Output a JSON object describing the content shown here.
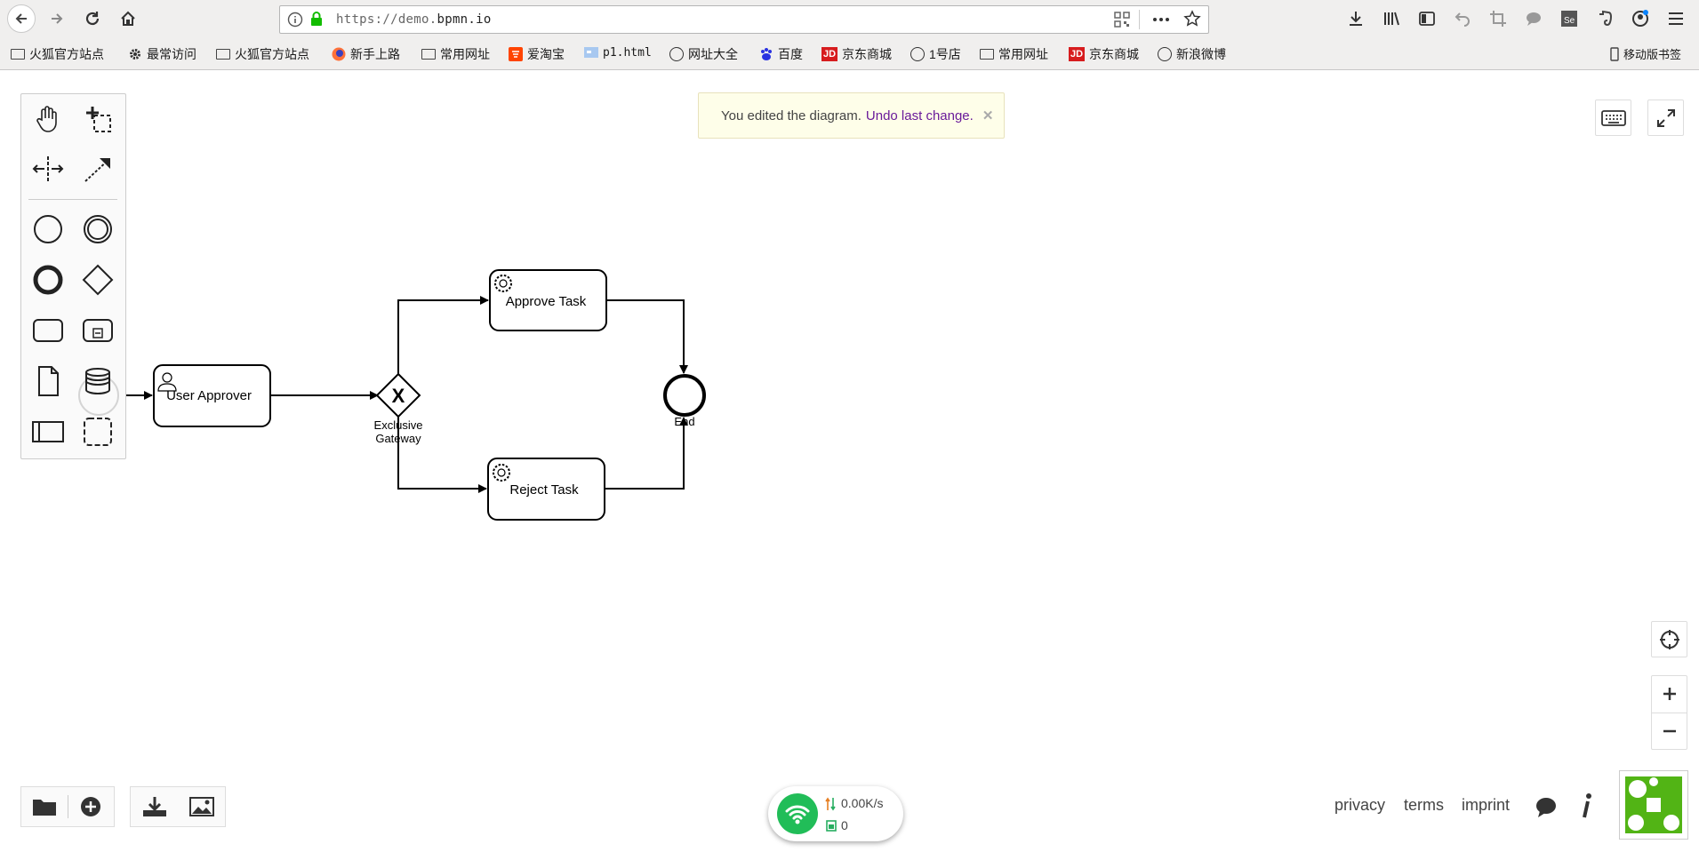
{
  "browser": {
    "url_scheme": "https://demo.",
    "url_domain": "bpmn.io"
  },
  "bookmarks": [
    {
      "label": "火狐官方站点",
      "icon": "folder-icon"
    },
    {
      "label": "最常访问",
      "icon": "gear-icon"
    },
    {
      "label": "火狐官方站点",
      "icon": "folder-icon"
    },
    {
      "label": "新手上路",
      "icon": "firefox-icon"
    },
    {
      "label": "常用网址",
      "icon": "folder-icon"
    },
    {
      "label": "爱淘宝",
      "icon": "taobao-icon"
    },
    {
      "label": "p1.html",
      "icon": "page-icon"
    },
    {
      "label": "网址大全",
      "icon": "globe-icon"
    },
    {
      "label": "百度",
      "icon": "baidu-icon"
    },
    {
      "label": "京东商城",
      "icon": "jd-icon"
    },
    {
      "label": "1号店",
      "icon": "globe-icon"
    },
    {
      "label": "常用网址",
      "icon": "folder-icon"
    },
    {
      "label": "京东商城",
      "icon": "jd-icon"
    },
    {
      "label": "新浪微博",
      "icon": "globe-icon"
    }
  ],
  "mobile_bookmarks": "移动版书签",
  "jd_glyph": "JD",
  "notification": {
    "text": "You edited the diagram.",
    "link": "Undo last change.",
    "close": "✕"
  },
  "diagram": {
    "user_task": "User Approver",
    "gateway_label_line1": "Exclusive",
    "gateway_label_line2": "Gateway",
    "gateway_marker": "X",
    "approve_task": "Approve Task",
    "reject_task": "Reject Task",
    "end_event": "End"
  },
  "footer": {
    "privacy": "privacy",
    "terms": "terms",
    "imprint": "imprint"
  },
  "network_widget": {
    "speed": "0.00K/s",
    "count": "0"
  },
  "colors": {
    "accent_link": "#6a1b9a",
    "logo_green": "#52b415",
    "wifi_green": "#21bd58"
  }
}
